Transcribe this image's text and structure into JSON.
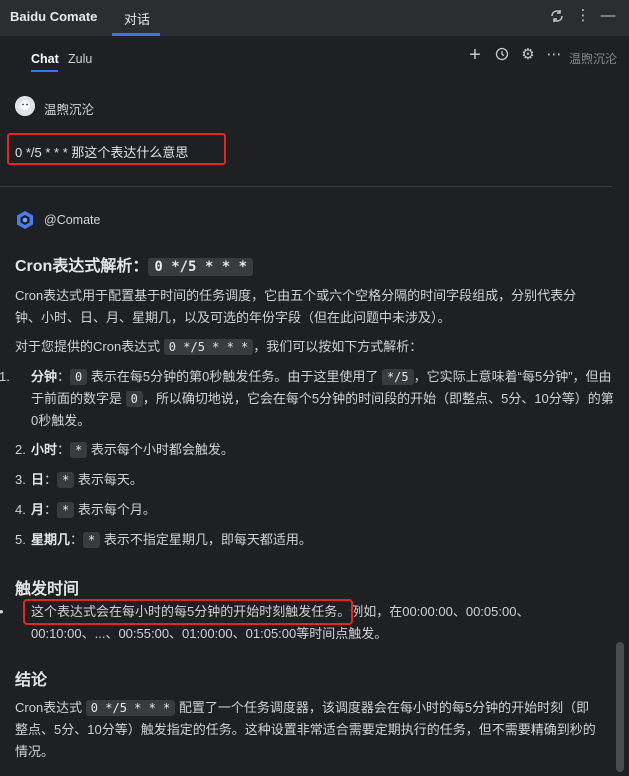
{
  "titlebar": {
    "app_name": "Baidu Comate",
    "tab_label": "对话",
    "icons": [
      "refresh-icon",
      "more-vertical-icon",
      "minimize-icon"
    ]
  },
  "subbar": {
    "tabs": [
      {
        "label": "Chat",
        "active": true
      },
      {
        "label": "Zulu",
        "active": false
      }
    ],
    "icons": [
      "plus-icon",
      "history-icon",
      "settings-icon",
      "more-horizontal-icon"
    ],
    "user": "温煦沉沦"
  },
  "user_message": {
    "name": "温煦沉沦",
    "text": "0 */5 * * * 那这个表达什么意思"
  },
  "bot": {
    "name": "@Comate",
    "heading": "Cron表达式解析：",
    "heading_code": "0 */5 * * *",
    "intro": "Cron表达式用于配置基于时间的任务调度，它由五个或六个空格分隔的时间字段组成，分别代表分钟、小时、日、月、星期几，以及可选的年份字段（但在此问题中未涉及）。",
    "p2_before": "对于您提供的Cron表达式 ",
    "p2_code": "0 */5 * * *",
    "p2_after": "，我们可以按如下方式解析：",
    "items": [
      {
        "num": "1.",
        "label": "分钟",
        "sep": "：",
        "code": "0",
        "text1": " 表示在每5分钟的第0秒触发任务。由于这里使用了 ",
        "code2": "*/5",
        "text2": "，它实际上意味着“每5分钟”，但由于前面的数字是 ",
        "code3": "0",
        "text3": "，所以确切地说，它会在每个5分钟的时间段的开始（即整点、5分、10分等）的第0秒触发。"
      },
      {
        "num": "2.",
        "label": "小时",
        "sep": "：",
        "code": "*",
        "text1": " 表示每个小时都会触发。"
      },
      {
        "num": "3.",
        "label": "日",
        "sep": "：",
        "code": "*",
        "text1": " 表示每天。"
      },
      {
        "num": "4.",
        "label": "月",
        "sep": "：",
        "code": "*",
        "text1": " 表示每个月。"
      },
      {
        "num": "5.",
        "label": "星期几",
        "sep": "：",
        "code": "*",
        "text1": " 表示不指定星期几，即每天都适用。"
      }
    ],
    "trigger_heading": "触发时间",
    "trigger_bullet": "•",
    "trigger_highlight": "这个表达式会在每小时的每5分钟的开始时刻触发任务。",
    "trigger_rest": "例如，在00:00:00、00:05:00、00:10:00、...、00:55:00、01:00:00、01:05:00等时间点触发。",
    "conclusion_heading": "结论",
    "conclusion_before": "Cron表达式 ",
    "conclusion_code": "0 */5 * * *",
    "conclusion_after": " 配置了一个任务调度器，该调度器会在每小时的每5分钟的开始时刻（即整点、5分、10分等）触发指定的任务。这种设置非常适合需要定期执行的任务，但不需要精确到秒的情况。"
  }
}
